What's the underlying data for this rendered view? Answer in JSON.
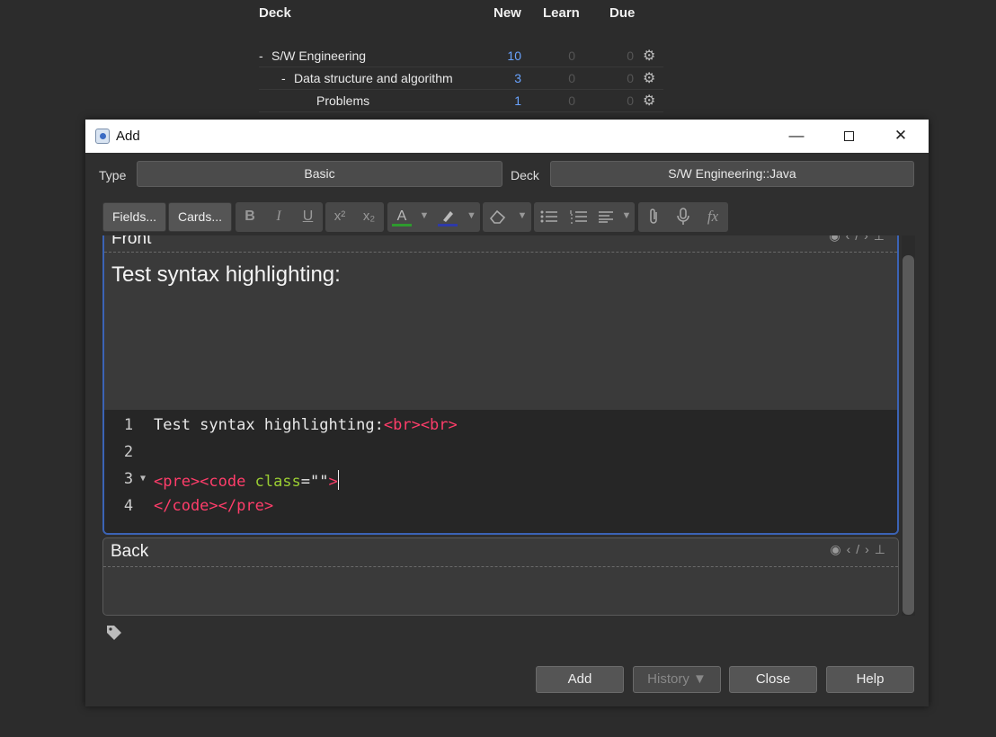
{
  "deck_list": {
    "headers": {
      "deck": "Deck",
      "new": "New",
      "learn": "Learn",
      "due": "Due"
    },
    "rows": [
      {
        "prefix": "-",
        "name": "S/W Engineering",
        "new": "10",
        "learn": "0",
        "due": "0"
      },
      {
        "prefix": "-",
        "name": "Data structure and algorithm",
        "new": "3",
        "learn": "0",
        "due": "0"
      },
      {
        "prefix": "",
        "name": "Problems",
        "new": "1",
        "learn": "0",
        "due": "0"
      }
    ]
  },
  "window": {
    "title": "Add",
    "type_label": "Type",
    "type_value": "Basic",
    "deck_label": "Deck",
    "deck_value": "S/W Engineering::Java"
  },
  "toolbar": {
    "fields_label": "Fields...",
    "cards_label": "Cards...",
    "bold": "B",
    "italic": "I",
    "underline": "U",
    "superscript": "x²",
    "subscript": "x₂",
    "text_color": "A",
    "function": "fx"
  },
  "fields": {
    "front": {
      "name": "Front",
      "rich_text": "Test syntax highlighting:"
    },
    "back": {
      "name": "Back"
    }
  },
  "code": {
    "lines": [
      {
        "num": "1",
        "plain": "Test syntax highlighting:",
        "tag": "<br><br>"
      },
      {
        "num": "2"
      },
      {
        "num": "3",
        "tag_open": "<pre><code",
        "attr": " class",
        "eq": "=\"\"",
        "tag_close": ">"
      },
      {
        "num": "4",
        "tag": "</code></pre>"
      }
    ]
  },
  "buttons": {
    "add": "Add",
    "history": "History ▼",
    "close": "Close",
    "help": "Help"
  },
  "colors": {
    "accent_blue": "#3b63b5",
    "tag_pink": "#ff3d6a",
    "attr_green": "#9acd32",
    "link_blue": "#69a3ff"
  }
}
